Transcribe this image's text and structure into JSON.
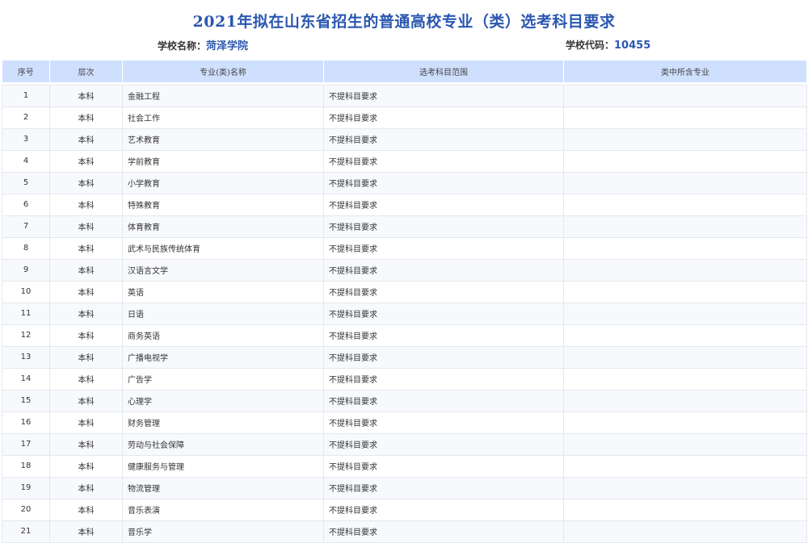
{
  "title": "2021年拟在山东省招生的普通高校专业（类）选考科目要求",
  "school": {
    "label": "学校名称：",
    "name": "菏泽学院"
  },
  "code": {
    "label": "学校代码：",
    "value": "10455"
  },
  "table": {
    "headers": [
      "序号",
      "层次",
      "专业(类)名称",
      "选考科目范围",
      "类中所含专业"
    ],
    "rows": [
      {
        "idx": "1",
        "level": "本科",
        "name": "金融工程",
        "req": "不提科目要求",
        "sub": ""
      },
      {
        "idx": "2",
        "level": "本科",
        "name": "社会工作",
        "req": "不提科目要求",
        "sub": ""
      },
      {
        "idx": "3",
        "level": "本科",
        "name": "艺术教育",
        "req": "不提科目要求",
        "sub": ""
      },
      {
        "idx": "4",
        "level": "本科",
        "name": "学前教育",
        "req": "不提科目要求",
        "sub": ""
      },
      {
        "idx": "5",
        "level": "本科",
        "name": "小学教育",
        "req": "不提科目要求",
        "sub": ""
      },
      {
        "idx": "6",
        "level": "本科",
        "name": "特殊教育",
        "req": "不提科目要求",
        "sub": ""
      },
      {
        "idx": "7",
        "level": "本科",
        "name": "体育教育",
        "req": "不提科目要求",
        "sub": ""
      },
      {
        "idx": "8",
        "level": "本科",
        "name": "武术与民族传统体育",
        "req": "不提科目要求",
        "sub": ""
      },
      {
        "idx": "9",
        "level": "本科",
        "name": "汉语言文学",
        "req": "不提科目要求",
        "sub": ""
      },
      {
        "idx": "10",
        "level": "本科",
        "name": "英语",
        "req": "不提科目要求",
        "sub": ""
      },
      {
        "idx": "11",
        "level": "本科",
        "name": "日语",
        "req": "不提科目要求",
        "sub": ""
      },
      {
        "idx": "12",
        "level": "本科",
        "name": "商务英语",
        "req": "不提科目要求",
        "sub": ""
      },
      {
        "idx": "13",
        "level": "本科",
        "name": "广播电视学",
        "req": "不提科目要求",
        "sub": ""
      },
      {
        "idx": "14",
        "level": "本科",
        "name": "广告学",
        "req": "不提科目要求",
        "sub": ""
      },
      {
        "idx": "15",
        "level": "本科",
        "name": "心理学",
        "req": "不提科目要求",
        "sub": ""
      },
      {
        "idx": "16",
        "level": "本科",
        "name": "财务管理",
        "req": "不提科目要求",
        "sub": ""
      },
      {
        "idx": "17",
        "level": "本科",
        "name": "劳动与社会保障",
        "req": "不提科目要求",
        "sub": ""
      },
      {
        "idx": "18",
        "level": "本科",
        "name": "健康服务与管理",
        "req": "不提科目要求",
        "sub": ""
      },
      {
        "idx": "19",
        "level": "本科",
        "name": "物流管理",
        "req": "不提科目要求",
        "sub": ""
      },
      {
        "idx": "20",
        "level": "本科",
        "name": "音乐表演",
        "req": "不提科目要求",
        "sub": ""
      },
      {
        "idx": "21",
        "level": "本科",
        "name": "音乐学",
        "req": "不提科目要求",
        "sub": ""
      }
    ]
  }
}
